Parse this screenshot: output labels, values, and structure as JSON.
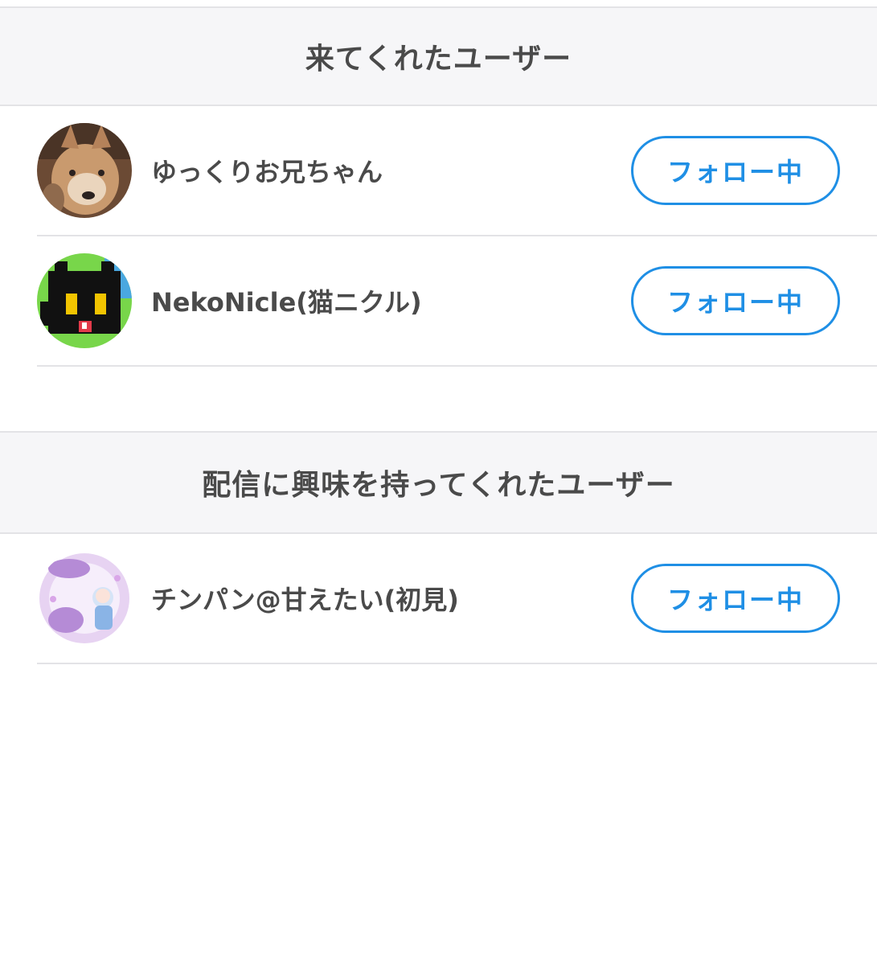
{
  "sections": [
    {
      "title": "来てくれたユーザー",
      "users": [
        {
          "name": "ゆっくりお兄ちゃん",
          "follow_label": "フォロー中",
          "avatar_icon": "shiba-dog-avatar"
        },
        {
          "name": "NekoNicle(猫ニクル)",
          "follow_label": "フォロー中",
          "avatar_icon": "pixel-cat-avatar"
        }
      ]
    },
    {
      "title": "配信に興味を持ってくれたユーザー",
      "users": [
        {
          "name": "チンパン@甘えたい(初見)",
          "follow_label": "フォロー中",
          "avatar_icon": "anime-badge-avatar"
        }
      ]
    }
  ],
  "colors": {
    "accent": "#1f8fe5",
    "header_bg": "#f6f6f8",
    "divider": "#e3e3e6",
    "text": "#4a4a4a"
  }
}
